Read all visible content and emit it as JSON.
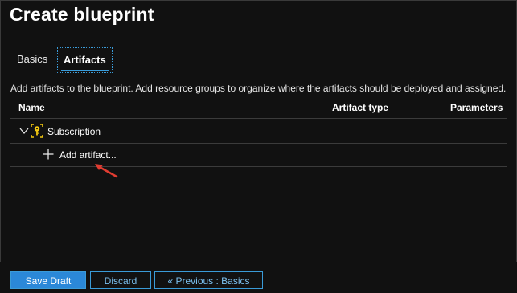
{
  "page": {
    "title": "Create blueprint"
  },
  "tabs": [
    {
      "label": "Basics",
      "selected": false
    },
    {
      "label": "Artifacts",
      "selected": true
    }
  ],
  "description": "Add artifacts to the blueprint. Add resource groups to organize where the artifacts should be deployed and assigned.",
  "table": {
    "columns": [
      "Name",
      "Artifact type",
      "Parameters"
    ],
    "rows": [
      {
        "name": "Subscription",
        "icon": "subscription-key-icon",
        "expanded": true
      },
      {
        "name": "Add artifact...",
        "icon": "plus-icon"
      }
    ]
  },
  "footer": {
    "save_label": "Save Draft",
    "discard_label": "Discard",
    "previous_label": "« Previous : Basics"
  },
  "colors": {
    "accent": "#2b88d8",
    "link": "#7cc1f0",
    "annotation_arrow": "#e03c31",
    "subscription_icon": "#f2c811"
  }
}
